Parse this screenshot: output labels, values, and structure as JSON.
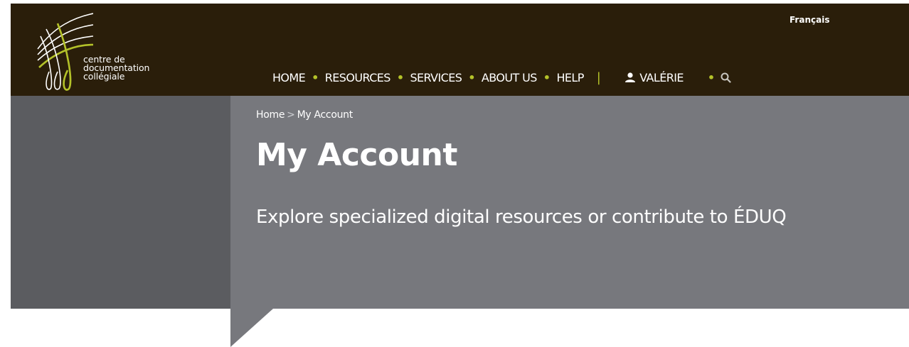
{
  "colors": {
    "topbar": "#2a1e0a",
    "accent": "#b4c229",
    "hero": "#77787d",
    "hero_dark": "#5b5c60"
  },
  "logo": {
    "line1": "centre de",
    "line2": "documentation",
    "line3": "collégiale"
  },
  "language_link": "Français",
  "nav": {
    "home": "HOME",
    "resources": "RESOURCES",
    "services": "SERVICES",
    "about": "ABOUT US",
    "help": "HELP",
    "separator": "•",
    "pipe": "|",
    "user": "VALÉRIE",
    "user_icon": "person-icon",
    "search_icon": "search-icon"
  },
  "breadcrumb": {
    "home": "Home",
    "separator": ">",
    "current": "My Account"
  },
  "page": {
    "title": "My Account",
    "subtitle": "Explore specialized digital resources or contribute to ÉDUQ"
  }
}
